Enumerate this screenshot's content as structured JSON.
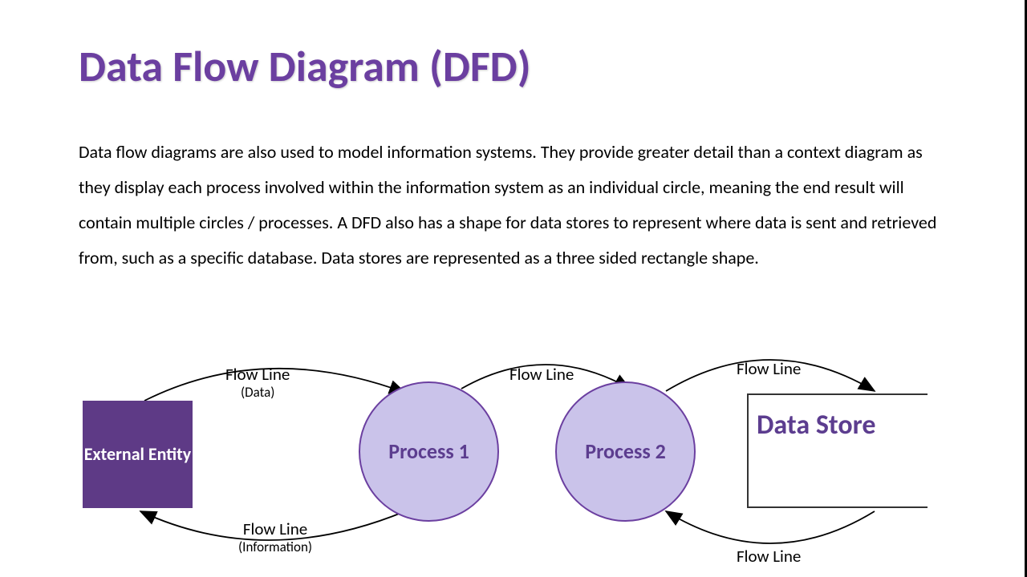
{
  "title": "Data Flow Diagram (DFD)",
  "description": "Data flow diagrams are also used to model information systems. They provide greater detail than a context diagram as they display each process involved within the information system as an individual circle, meaning the end result will contain multiple circles / processes. A DFD also has a shape for data stores to represent where data is sent and retrieved from, such as a specific database. Data stores are represented as a three sided rectangle shape.",
  "diagram": {
    "external_entity": "External Entity",
    "process_1": "Process 1",
    "process_2": "Process 2",
    "data_store": "Data Store",
    "flows": {
      "top_left": {
        "main": "Flow Line",
        "sub": "(Data)"
      },
      "top_mid": {
        "main": "Flow Line"
      },
      "top_right": {
        "main": "Flow Line"
      },
      "bottom_left": {
        "main": "Flow Line",
        "sub": "(Information)"
      },
      "bottom_right": {
        "main": "Flow Line"
      }
    }
  }
}
